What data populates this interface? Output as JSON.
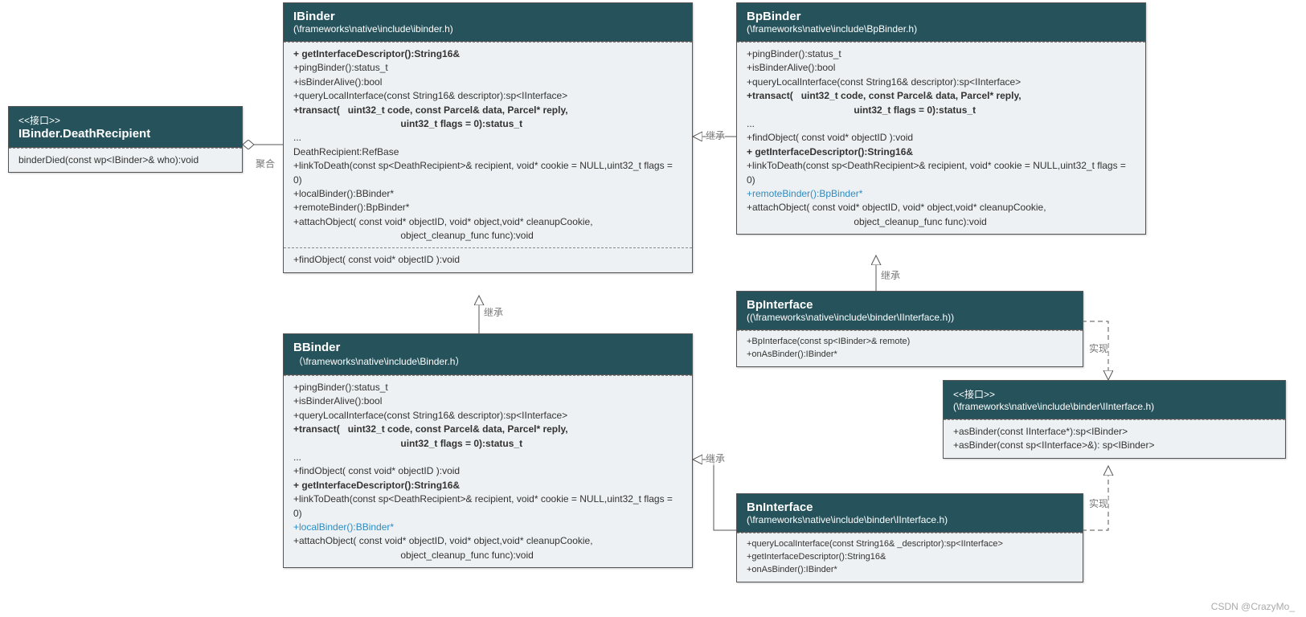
{
  "watermark": "CSDN @CrazyMo_",
  "labels": {
    "agg": "聚合",
    "inh1": "继承",
    "inh2": "继承",
    "inh3": "继承",
    "inh4": "继承",
    "impl1": "实现",
    "impl2": "实现"
  },
  "boxes": {
    "death": {
      "stereo": "<<接口>>",
      "title": "IBinder.DeathRecipient",
      "c1": [
        "binderDied(const wp<IBinder>& who):void"
      ]
    },
    "ibinder": {
      "title": "IBinder",
      "sub": "(\\frameworks\\native\\include\\ibinder.h)",
      "c1": [
        {
          "t": "+ getInterfaceDescriptor():String16&",
          "b": true
        },
        {
          "t": "+pingBinder():status_t"
        },
        {
          "t": "+isBinderAlive():bool"
        },
        {
          "t": "+queryLocalInterface(const String16& descriptor):sp<IInterface>"
        },
        {
          "t": "+transact(   uint32_t code, const Parcel& data, Parcel* reply,",
          "b": true
        },
        {
          "t": "                                        uint32_t flags = 0):status_t",
          "b": true
        },
        {
          "t": "..."
        },
        {
          "t": "DeathRecipient:RefBase"
        },
        {
          "t": "+linkToDeath(const sp<DeathRecipient>& recipient, void* cookie = NULL,uint32_t flags = 0)"
        },
        {
          "t": "+localBinder():BBinder*"
        },
        {
          "t": "+remoteBinder():BpBinder*"
        },
        {
          "t": "+attachObject( const void* objectID, void* object,void* cleanupCookie,"
        },
        {
          "t": "                                        object_cleanup_func func):void"
        }
      ],
      "c2": [
        {
          "t": "+findObject( const void* objectID ):void"
        }
      ]
    },
    "bpbinder": {
      "title": "BpBinder",
      "sub": "(\\frameworks\\native\\include\\BpBinder.h)",
      "c1": [
        {
          "t": "+pingBinder():status_t"
        },
        {
          "t": "+isBinderAlive():bool"
        },
        {
          "t": "+queryLocalInterface(const String16& descriptor):sp<IInterface>"
        },
        {
          "t": "+transact(   uint32_t code, const Parcel& data, Parcel* reply,",
          "b": true
        },
        {
          "t": "                                        uint32_t flags = 0):status_t",
          "b": true
        },
        {
          "t": "..."
        },
        {
          "t": "+findObject( const void* objectID ):void"
        },
        {
          "t": "+ getInterfaceDescriptor():String16&",
          "b": true
        },
        {
          "t": "+linkToDeath(const sp<DeathRecipient>& recipient, void* cookie = NULL,uint32_t flags = 0)"
        },
        {
          "t": "+remoteBinder():BpBinder*",
          "link": true
        },
        {
          "t": "+attachObject( const void* objectID, void* object,void* cleanupCookie,"
        },
        {
          "t": "                                        object_cleanup_func func):void"
        }
      ]
    },
    "bbinder": {
      "title": "BBinder",
      "sub": "（\\frameworks\\native\\include\\Binder.h）",
      "c1": [
        {
          "t": "+pingBinder():status_t"
        },
        {
          "t": "+isBinderAlive():bool"
        },
        {
          "t": "+queryLocalInterface(const String16& descriptor):sp<IInterface>"
        },
        {
          "t": "+transact(   uint32_t code, const Parcel& data, Parcel* reply,",
          "b": true
        },
        {
          "t": "                                        uint32_t flags = 0):status_t",
          "b": true
        },
        {
          "t": "..."
        },
        {
          "t": "+findObject( const void* objectID ):void"
        },
        {
          "t": "+ getInterfaceDescriptor():String16&",
          "b": true
        },
        {
          "t": "+linkToDeath(const sp<DeathRecipient>& recipient, void* cookie = NULL,uint32_t flags = 0)"
        },
        {
          "t": "+localBinder():BBinder*",
          "link": true
        },
        {
          "t": "+attachObject( const void* objectID, void* object,void* cleanupCookie,"
        },
        {
          "t": "                                        object_cleanup_func func):void"
        }
      ]
    },
    "bpinterface": {
      "title": "BpInterface",
      "sub": "((\\frameworks\\native\\include\\binder\\IInterface.h))",
      "c1": [
        {
          "t": "+BpInterface(const sp<IBinder>& remote)"
        },
        {
          "t": "+onAsBinder():IBinder*"
        }
      ]
    },
    "bninterface": {
      "title": "BnInterface",
      "sub": "(\\frameworks\\native\\include\\binder\\IInterface.h)",
      "c1": [
        {
          "t": "+queryLocalInterface(const String16& _descriptor):sp<IInterface>"
        },
        {
          "t": "+getInterfaceDescriptor():String16&"
        },
        {
          "t": "+onAsBinder():IBinder*"
        }
      ]
    },
    "iinterface": {
      "stereo": "<<接口>>",
      "sub": "(\\frameworks\\native\\include\\binder\\IInterface.h)",
      "c1": [
        {
          "t": "+asBinder(const IInterface*):sp<IBinder>"
        },
        {
          "t": "+asBinder(const sp<IInterface>&): sp<IBinder>"
        }
      ]
    }
  }
}
